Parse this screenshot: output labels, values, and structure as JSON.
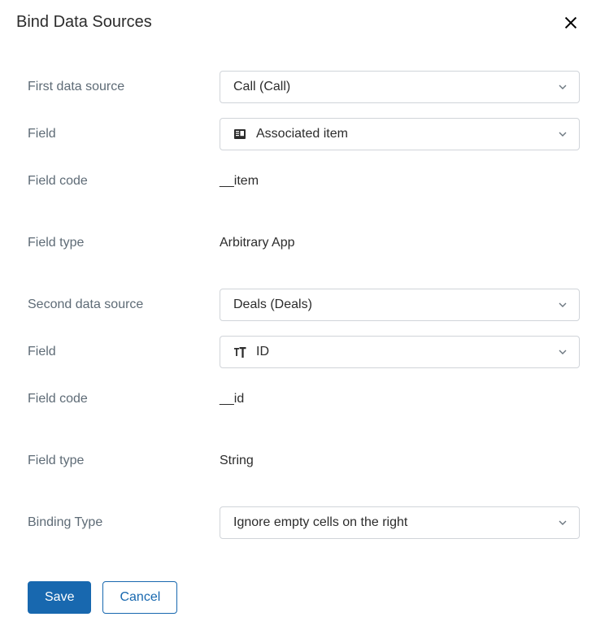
{
  "title": "Bind Data Sources",
  "labels": {
    "first_source": "First data source",
    "field1": "Field",
    "field_code1": "Field code",
    "field_type1": "Field type",
    "second_source": "Second data source",
    "field2": "Field",
    "field_code2": "Field code",
    "field_type2": "Field type",
    "binding_type": "Binding Type"
  },
  "values": {
    "first_source": "Call (Call)",
    "field1": "Associated item",
    "field_code1": "__item",
    "field_type1": "Arbitrary App",
    "second_source": "Deals (Deals)",
    "field2": "ID",
    "field_code2": "__id",
    "field_type2": "String",
    "binding_type": "Ignore empty cells on the right"
  },
  "buttons": {
    "save": "Save",
    "cancel": "Cancel"
  }
}
